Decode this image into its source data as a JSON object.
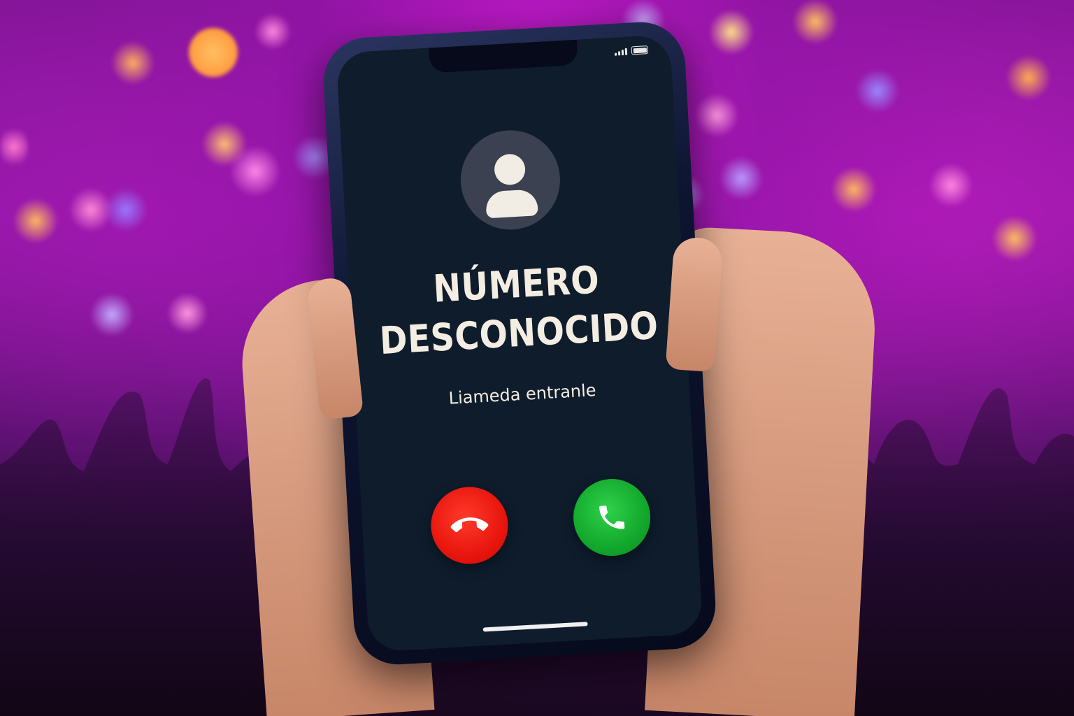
{
  "call_screen": {
    "caller_name_line1": "NÚMERO",
    "caller_name_line2": "DESCONOCIDO",
    "call_status": "Liameda entranle",
    "avatar_icon": "person-icon",
    "decline_icon": "phone-hangup-icon",
    "accept_icon": "phone-icon",
    "decline_color": "#e8160e",
    "accept_color": "#12a82c",
    "screen_color": "#0e1c2c"
  },
  "status_bar": {
    "signal_icon": "cellular-signal-icon",
    "battery_icon": "battery-icon"
  },
  "scene": {
    "background_color": "#8a1aa0",
    "bokeh_colors": [
      "#ffb347",
      "#ff5fd0",
      "#9a7cff",
      "#ffd27a"
    ]
  }
}
